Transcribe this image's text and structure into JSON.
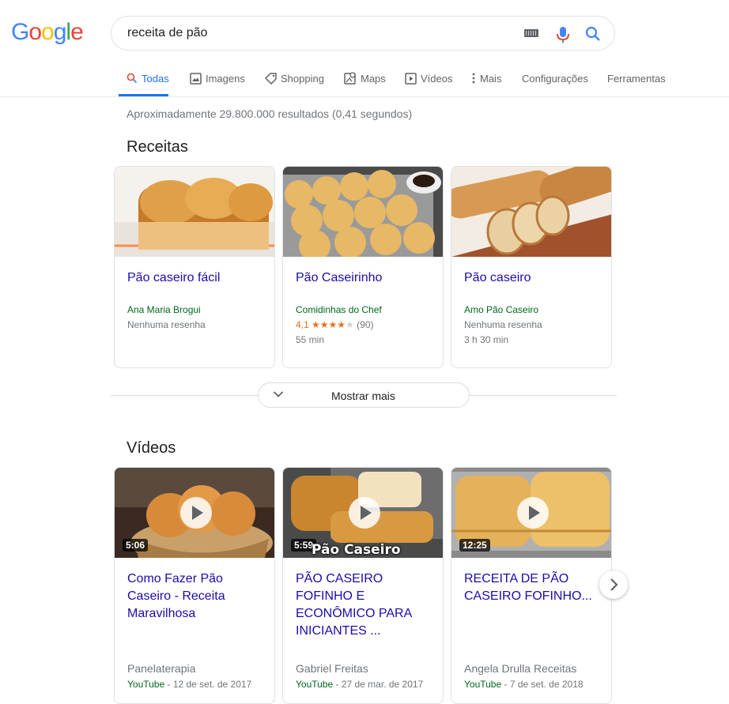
{
  "logo": {
    "letters": [
      "G",
      "o",
      "o",
      "g",
      "l",
      "e"
    ],
    "colors": [
      "#4285f4",
      "#ea4335",
      "#fbbc05",
      "#4285f4",
      "#34a853",
      "#ea4335"
    ]
  },
  "search": {
    "query": "receita de pão"
  },
  "tabs": [
    {
      "label": "Todas",
      "icon": "search-icon"
    },
    {
      "label": "Imagens",
      "icon": "image-icon"
    },
    {
      "label": "Shopping",
      "icon": "tag-icon"
    },
    {
      "label": "Maps",
      "icon": "map-icon"
    },
    {
      "label": "Vídeos",
      "icon": "video-icon"
    },
    {
      "label": "Mais",
      "icon": "more-vert-icon"
    },
    {
      "label": "Configurações"
    },
    {
      "label": "Ferramentas"
    }
  ],
  "results_stats": "Aproximadamente 29.800.000 resultados (0,41 segundos)",
  "recipes": {
    "heading": "Receitas",
    "items": [
      {
        "title": "Pão caseiro fácil",
        "source": "Ana Maria Brogui",
        "reviews": "Nenhuma resenha"
      },
      {
        "title": "Pão Caseirinho",
        "source": "Comidinhas do Chef",
        "rating": "4,1",
        "rating_count": "(90)",
        "stars": 4,
        "time": "55 min"
      },
      {
        "title": "Pão caseiro",
        "source": "Amo Pão Caseiro",
        "reviews": "Nenhuma resenha",
        "time": "3 h 30 min"
      }
    ],
    "show_more": "Mostrar mais"
  },
  "videos": {
    "heading": "Vídeos",
    "items": [
      {
        "title": "Como Fazer Pão Caseiro - Receita Maravilhosa",
        "duration": "5:06",
        "channel": "Panelaterapia",
        "platform": "YouTube",
        "date": " - 12 de set. de 2017"
      },
      {
        "title": "PÃO CASEIRO FOFINHO E ECONÔMICO PARA INICIANTES ...",
        "duration": "5:59",
        "overlay": "Pão Caseiro",
        "channel": "Gabriel Freitas",
        "platform": "YouTube",
        "date": " - 27 de mar. de 2017"
      },
      {
        "title": "RECEITA DE PÃO CASEIRO FOFINHO...",
        "duration": "12:25",
        "channel": "Angela Drulla Receitas",
        "platform": "YouTube",
        "date": " - 7 de set. de 2018"
      }
    ]
  },
  "colors": {
    "link": "#1a0dab",
    "green": "#006621",
    "accent": "#1a73e8",
    "star": "#e7711b"
  }
}
